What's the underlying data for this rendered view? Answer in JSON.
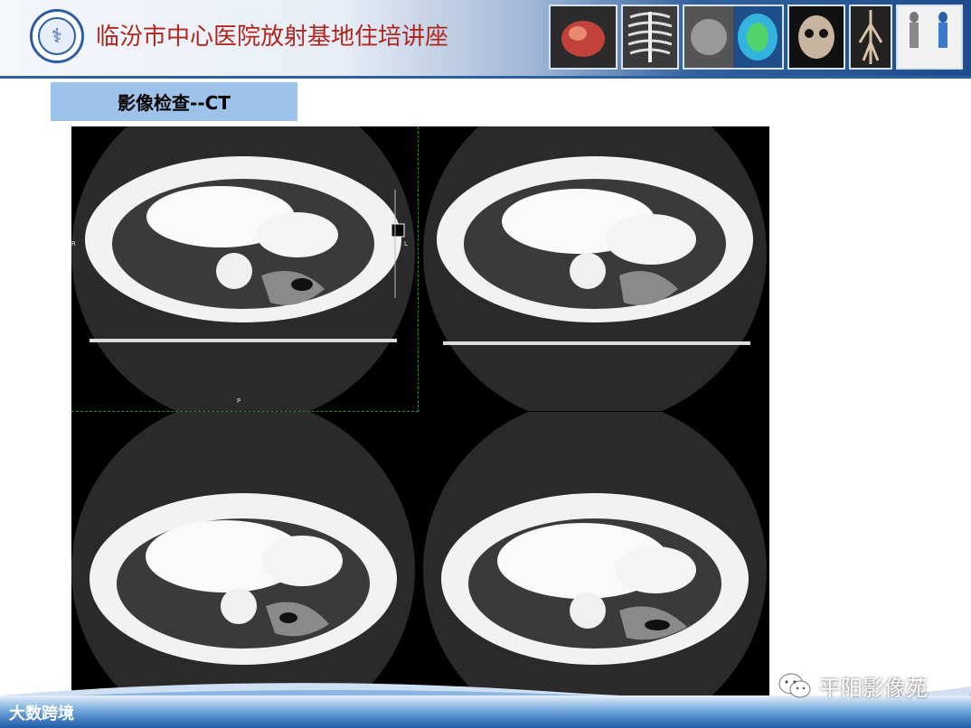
{
  "header": {
    "hospital_title": "临汾市中心医院放射基地住培讲座",
    "logo_glyph": "⚕",
    "thumbnails": [
      "heart-3d-icon",
      "ribcage-3d-icon",
      "brain-ct-icon",
      "brain-perfusion-icon",
      "skull-3d-icon",
      "vessel-3d-icon",
      "body-scan-icon"
    ]
  },
  "section": {
    "title": "影像检查--CT"
  },
  "ct": {
    "label_r": "R",
    "label_l": "L",
    "label_p": "P"
  },
  "footer": {
    "brand": "大数跨境",
    "wechat": "平阳影像苑"
  },
  "colors": {
    "title_red": "#b3261e",
    "section_blue": "#9ec3ea",
    "header_blue": "#1d4d8e"
  }
}
